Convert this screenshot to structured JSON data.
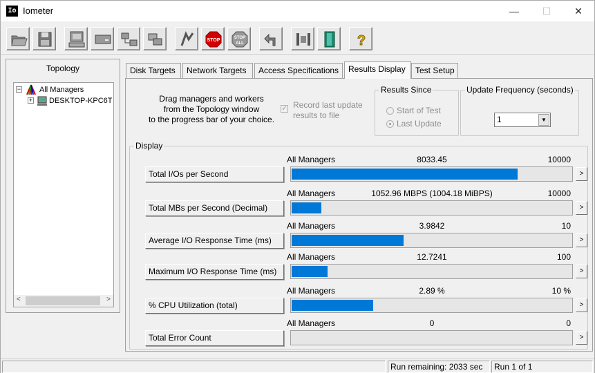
{
  "window": {
    "title": "Iometer",
    "icon_text": "Io",
    "minimize": "—",
    "maximize": "☐",
    "close": "✕"
  },
  "toolbar": {
    "buttons": [
      "open-config",
      "save-config",
      "new-disk-worker",
      "new-network-worker",
      "duplicate-worker",
      "disconnect-manager",
      "start-tests",
      "stop-current-test",
      "stop-all-tests",
      "reset-workers",
      "exit-iometer-prompt",
      "exit",
      "about"
    ]
  },
  "topology": {
    "title": "Topology",
    "items": [
      {
        "label": "All Managers",
        "expander": "−"
      },
      {
        "label": "DESKTOP-KPC6T",
        "expander": "+"
      }
    ],
    "scroll_left": "<",
    "scroll_right": ">"
  },
  "tabs": [
    "Disk Targets",
    "Network Targets",
    "Access Specifications",
    "Results Display",
    "Test Setup"
  ],
  "active_tab": "Results Display",
  "results": {
    "drag_text": [
      "Drag managers and workers",
      "from the Topology window",
      "to the progress bar of your choice."
    ],
    "record_line1": "Record last update",
    "record_line2": "results to file",
    "record_check": "✓",
    "results_since": {
      "legend": "Results Since",
      "start_of_test": "Start of Test",
      "last_update": "Last Update"
    },
    "update_frequency": {
      "legend": "Update Frequency (seconds)",
      "value": "1",
      "arrow": "▼"
    },
    "display_legend": "Display",
    "metrics": [
      {
        "button": "Total I/Os per Second",
        "source": "All Managers",
        "value": "8033.45",
        "max": "10000",
        "fraction": 0.803,
        "more": ">"
      },
      {
        "button": "Total MBs per Second (Decimal)",
        "source": "All Managers",
        "value": "1052.96 MBPS (1004.18 MiBPS)",
        "max": "10000",
        "fraction": 0.105,
        "more": ">"
      },
      {
        "button": "Average I/O Response Time (ms)",
        "source": "All Managers",
        "value": "3.9842",
        "max": "10",
        "fraction": 0.398,
        "more": ">"
      },
      {
        "button": "Maximum I/O Response Time (ms)",
        "source": "All Managers",
        "value": "12.7241",
        "max": "100",
        "fraction": 0.127,
        "more": ">"
      },
      {
        "button": "% CPU Utilization (total)",
        "source": "All Managers",
        "value": "2.89 %",
        "max": "10 %",
        "fraction": 0.289,
        "more": ">"
      },
      {
        "button": "Total Error Count",
        "source": "All Managers",
        "value": "0",
        "max": "0",
        "fraction": 0,
        "more": ">"
      }
    ]
  },
  "status": {
    "run_remaining": "Run remaining: 2033 sec",
    "run_of": "Run 1 of 1"
  }
}
